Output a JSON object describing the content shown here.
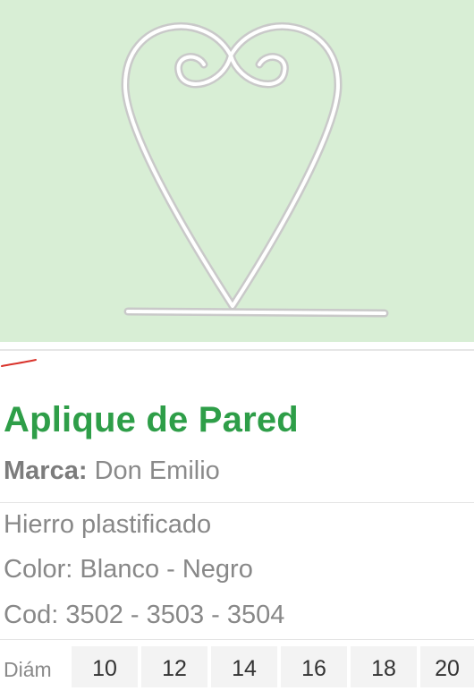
{
  "product": {
    "image_alt": "heart-shaped wall bracket",
    "title": "Aplique de Pared",
    "brand_label": "Marca:",
    "brand_value": "Don Emilio",
    "description_lines": [
      "Hierro plastificado",
      "Color: Blanco - Negro",
      "Cod: 3502 - 3503 - 3504"
    ],
    "sizes": {
      "label": "Diám",
      "values": [
        "10",
        "12",
        "14",
        "16",
        "18",
        "20"
      ]
    }
  },
  "colors": {
    "hero_background": "#d8eed5",
    "title": "#2e9e48",
    "accent_mark": "#d9332b"
  }
}
